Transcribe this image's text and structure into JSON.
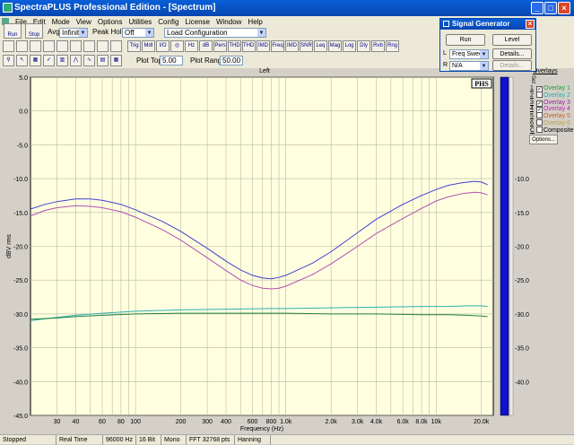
{
  "window": {
    "title": "SpectraPLUS Professional Edition - [Spectrum]"
  },
  "menu": [
    "File",
    "Edit",
    "Mode",
    "View",
    "Options",
    "Utilities",
    "Config",
    "License",
    "Window",
    "Help"
  ],
  "toolbar1": {
    "run_label": "Run",
    "stop_label": "Stop",
    "avg_label": "Avg:",
    "avg_value": "Infinite",
    "peak_label": "Peak Hold:",
    "peak_value": "Off",
    "config_value": "Load Configuration"
  },
  "toolbar2": {
    "buttons": [
      "Trig",
      "Mdt",
      "I/O",
      "",
      "Hz",
      "dB",
      "Pers",
      "THD",
      "THD N",
      "IMD",
      "Freq",
      "IMD",
      "SNR",
      "Leq",
      "Mag",
      "Log",
      "Dly",
      "Rvb",
      "Rng"
    ]
  },
  "toolbar3": {
    "plot_top_label": "Plot Top:",
    "plot_top_value": "5.00",
    "plot_range_label": "Plot Range:",
    "plot_range_value": "50.00"
  },
  "signal_generator": {
    "title": "Signal Generator",
    "run_label": "Run",
    "level_label": "Level",
    "l_label": "L",
    "l_value": "Freq Sweep",
    "l_details": "Details...",
    "r_label": "R",
    "r_value": "N/A",
    "r_details": "Details..."
  },
  "channel_label": "Left",
  "overlays": {
    "header": "Overlays",
    "set_label": "Set",
    "items": [
      {
        "num": "1",
        "label": "Overlay 1",
        "checked": true,
        "color": "#20a040"
      },
      {
        "num": "2",
        "label": "Overlay 2",
        "checked": false,
        "color": "#20b0b0"
      },
      {
        "num": "3",
        "label": "Overlay 3",
        "checked": true,
        "color": "#a020a0"
      },
      {
        "num": "4",
        "label": "Overlay 4",
        "checked": true,
        "color": "#c020c0"
      },
      {
        "num": "5",
        "label": "Overlay 5",
        "checked": false,
        "color": "#c06020"
      },
      {
        "num": "6",
        "label": "Overlay 6",
        "checked": false,
        "color": "#c0a040"
      },
      {
        "num": "C",
        "label": "Composite",
        "checked": false,
        "color": "#000000"
      }
    ],
    "options_label": "Options..."
  },
  "status": [
    "Stopped",
    "Real Time",
    "96000 Hz",
    "16 Bit",
    "Mono",
    "FFT 32768 pts",
    "Hanning"
  ],
  "chart_data": {
    "type": "line",
    "badge": "PHS",
    "xlabel": "Frequency (Hz)",
    "ylabel": "dBV rms",
    "xscale": "log",
    "xlim": [
      20,
      24000
    ],
    "ylim": [
      -45,
      5
    ],
    "y_ticks": [
      "5.0",
      "0.0",
      "-5.0",
      "-10.0",
      "-15.0",
      "-20.0",
      "-25.0",
      "-30.0",
      "-35.0",
      "-40.0",
      "-45.0"
    ],
    "y_tick_values": [
      5,
      0,
      -5,
      -10,
      -15,
      -20,
      -25,
      -30,
      -35,
      -40,
      -45
    ],
    "x_ticks": [
      "30",
      "40",
      "60",
      "80",
      "100",
      "200",
      "300",
      "400",
      "600",
      "800",
      "1.0k",
      "2.0k",
      "3.0k",
      "4.0k",
      "6.0k",
      "8.0k",
      "10k",
      "20.0k"
    ],
    "x_tick_values": [
      30,
      40,
      60,
      80,
      100,
      200,
      300,
      400,
      600,
      800,
      1000,
      2000,
      3000,
      4000,
      6000,
      8000,
      10000,
      20000
    ],
    "right_tick_labels": [
      "-10.0",
      "-15.0",
      "-20.0",
      "-25.0",
      "-30.0",
      "-35.0",
      "-40.0"
    ],
    "right_tick_values": [
      -10,
      -15,
      -20,
      -25,
      -30,
      -35,
      -40
    ],
    "series": [
      {
        "color": "#4040d0",
        "x": [
          20,
          25,
          30,
          40,
          50,
          60,
          80,
          100,
          150,
          200,
          300,
          400,
          500,
          600,
          700,
          800,
          900,
          1000,
          1500,
          2000,
          3000,
          4000,
          6000,
          8000,
          10000,
          12000,
          15000,
          18000,
          20000,
          22000
        ],
        "y": [
          -14.5,
          -13.8,
          -13.4,
          -13.0,
          -13.0,
          -13.2,
          -13.8,
          -14.6,
          -16.3,
          -17.8,
          -20.3,
          -22.2,
          -23.5,
          -24.3,
          -24.7,
          -24.8,
          -24.6,
          -24.3,
          -22.5,
          -20.8,
          -18.0,
          -16.0,
          -13.8,
          -12.5,
          -11.6,
          -11.0,
          -10.6,
          -10.4,
          -10.5,
          -10.9
        ]
      },
      {
        "color": "#b050b0",
        "x": [
          20,
          25,
          30,
          40,
          50,
          60,
          80,
          100,
          150,
          200,
          300,
          400,
          500,
          600,
          700,
          800,
          900,
          1000,
          1500,
          2000,
          3000,
          4000,
          6000,
          8000,
          10000,
          12000,
          15000,
          18000,
          20000,
          22000
        ],
        "y": [
          -15.5,
          -14.7,
          -14.3,
          -14.0,
          -14.1,
          -14.3,
          -14.9,
          -15.7,
          -17.5,
          -19.1,
          -21.7,
          -23.6,
          -25.0,
          -25.8,
          -26.2,
          -26.3,
          -26.2,
          -25.9,
          -24.2,
          -22.6,
          -20.0,
          -18.1,
          -15.9,
          -14.4,
          -13.3,
          -12.7,
          -12.2,
          -12.0,
          -12.1,
          -12.4
        ]
      },
      {
        "color": "#30b0b0",
        "x": [
          20,
          30,
          40,
          60,
          100,
          200,
          400,
          800,
          1000,
          2000,
          4000,
          8000,
          12000,
          16000,
          20000,
          22000
        ],
        "y": [
          -31.0,
          -30.5,
          -30.2,
          -29.9,
          -29.6,
          -29.4,
          -29.3,
          -29.2,
          -29.2,
          -29.1,
          -29.0,
          -28.9,
          -28.9,
          -28.8,
          -28.8,
          -28.9
        ]
      },
      {
        "color": "#208040",
        "x": [
          20,
          30,
          40,
          60,
          100,
          200,
          400,
          800,
          1000,
          2000,
          4000,
          8000,
          12000,
          16000,
          20000,
          22000
        ],
        "y": [
          -30.8,
          -30.6,
          -30.4,
          -30.2,
          -30.0,
          -29.9,
          -29.9,
          -29.9,
          -29.9,
          -30.0,
          -30.0,
          -30.1,
          -30.1,
          -30.2,
          -30.3,
          -30.4
        ]
      }
    ]
  }
}
